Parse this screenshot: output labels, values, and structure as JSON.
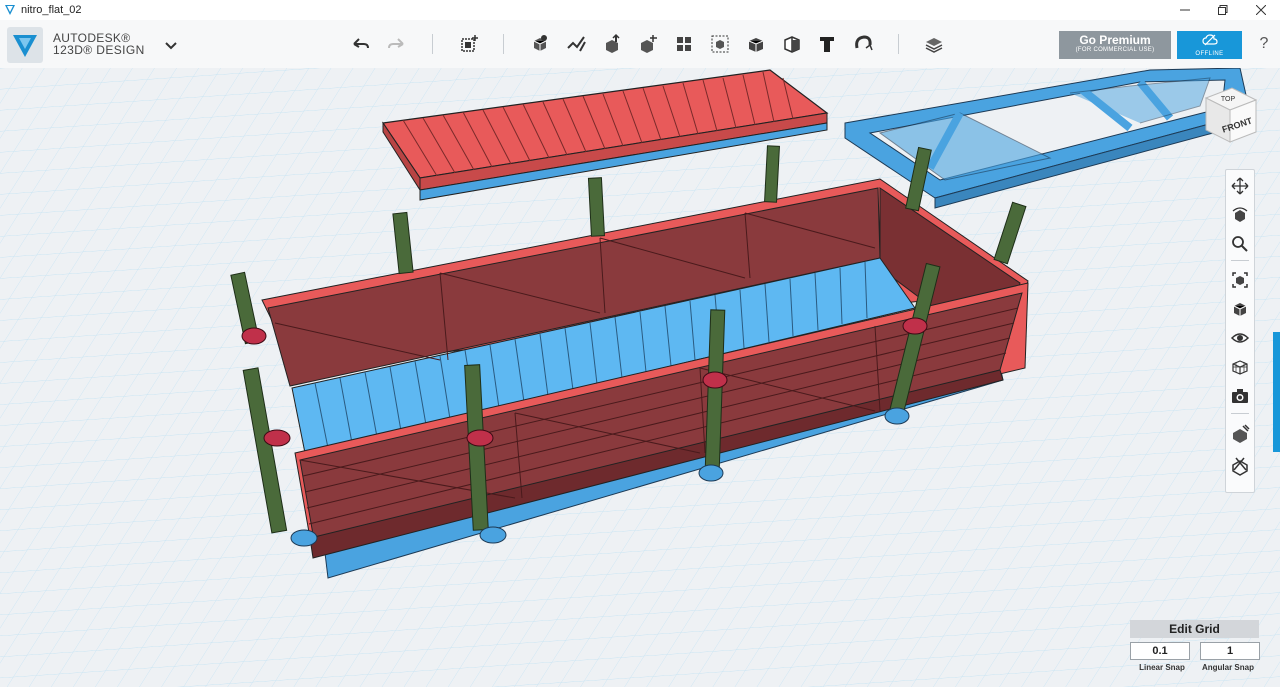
{
  "window": {
    "title": "nitro_flat_02",
    "controls": [
      "minimize-icon",
      "maximize-icon",
      "close-icon"
    ]
  },
  "brand": {
    "line1": "AUTODESK®",
    "line2": "123D® DESIGN"
  },
  "toolbar": {
    "tools": [
      "undo-icon",
      "redo-icon",
      "transform-icon",
      "primitives-icon",
      "sketch-icon",
      "construct-icon",
      "modify-icon",
      "pattern-icon",
      "group-icon",
      "combine-icon",
      "measure-icon",
      "text-icon",
      "snap-icon",
      "material-icon"
    ]
  },
  "premium": {
    "label": "Go Premium",
    "sublabel": "(FOR COMMERCIAL USE)"
  },
  "offline": {
    "label": "OFFLINE"
  },
  "help": "?",
  "viewcube": {
    "top": "TOP",
    "front": "FRONT"
  },
  "navbar": {
    "tools": [
      "pan-icon",
      "orbit-icon",
      "zoom-icon",
      "fit-icon",
      "views-icon",
      "visibility-icon",
      "wireframe-icon",
      "screenshot-icon",
      "material-icon",
      "outline-icon"
    ]
  },
  "edit_grid": {
    "title": "Edit Grid",
    "linear_snap_value": "0.1",
    "angular_snap_value": "1",
    "linear_snap_label": "Linear Snap",
    "angular_snap_label": "Angular Snap"
  },
  "colors": {
    "grid_background": "#eef1f4",
    "grid_line": "#a9d3ea",
    "deck_red": "#e85a5a",
    "hull_brown": "#8a3a3d",
    "frame_blue": "#4aa3e0",
    "floor_blue": "#5eb8f2",
    "stake_green": "#4a6a3a",
    "accent_blue": "#1897d9"
  }
}
